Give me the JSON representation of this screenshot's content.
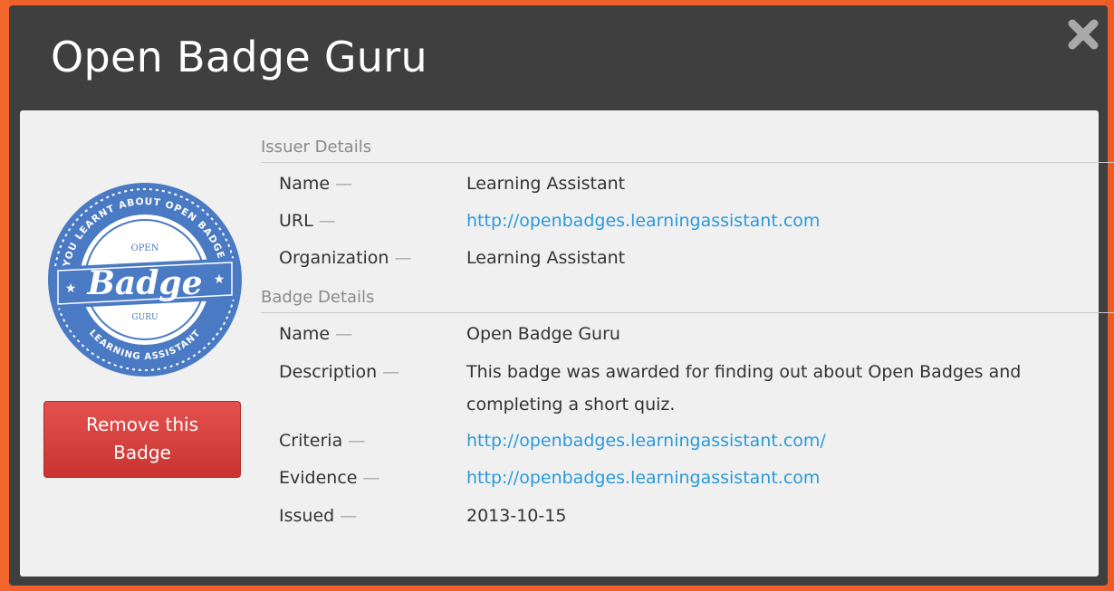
{
  "modal": {
    "title": "Open Badge Guru",
    "close_label": "×"
  },
  "badge_image": {
    "arc_top": "YOU LEARNT ABOUT OPEN BADGES",
    "arc_bottom": "LEARNING ASSISTANT",
    "small_top": "OPEN",
    "main_word": "Badge",
    "small_bottom": "GURU"
  },
  "remove_button": {
    "line1": "Remove this",
    "line2": "Badge"
  },
  "issuer": {
    "section_title": "Issuer Details",
    "name_label": "Name",
    "name_value": "Learning Assistant",
    "url_label": "URL",
    "url_value": "http://openbadges.learningassistant.com",
    "org_label": "Organization",
    "org_value": "Learning Assistant"
  },
  "badge": {
    "section_title": "Badge Details",
    "name_label": "Name",
    "name_value": "Open Badge Guru",
    "description_label": "Description",
    "description_line1": "This badge was awarded for finding out about Open Badges and",
    "description_line2": "completing a short quiz.",
    "criteria_label": "Criteria",
    "criteria_value": "http://openbadges.learningassistant.com/",
    "evidence_label": "Evidence",
    "evidence_value": "http://openbadges.learningassistant.com",
    "issued_label": "Issued",
    "issued_value": "2013-10-15"
  },
  "separator": "—",
  "colors": {
    "background": "#f0602a",
    "modal_header": "#3f3f3f",
    "panel": "#f0f0f0",
    "link": "#2a9ad9",
    "remove_button": "#d8403d",
    "badge_blue": "#4a7ac4"
  }
}
